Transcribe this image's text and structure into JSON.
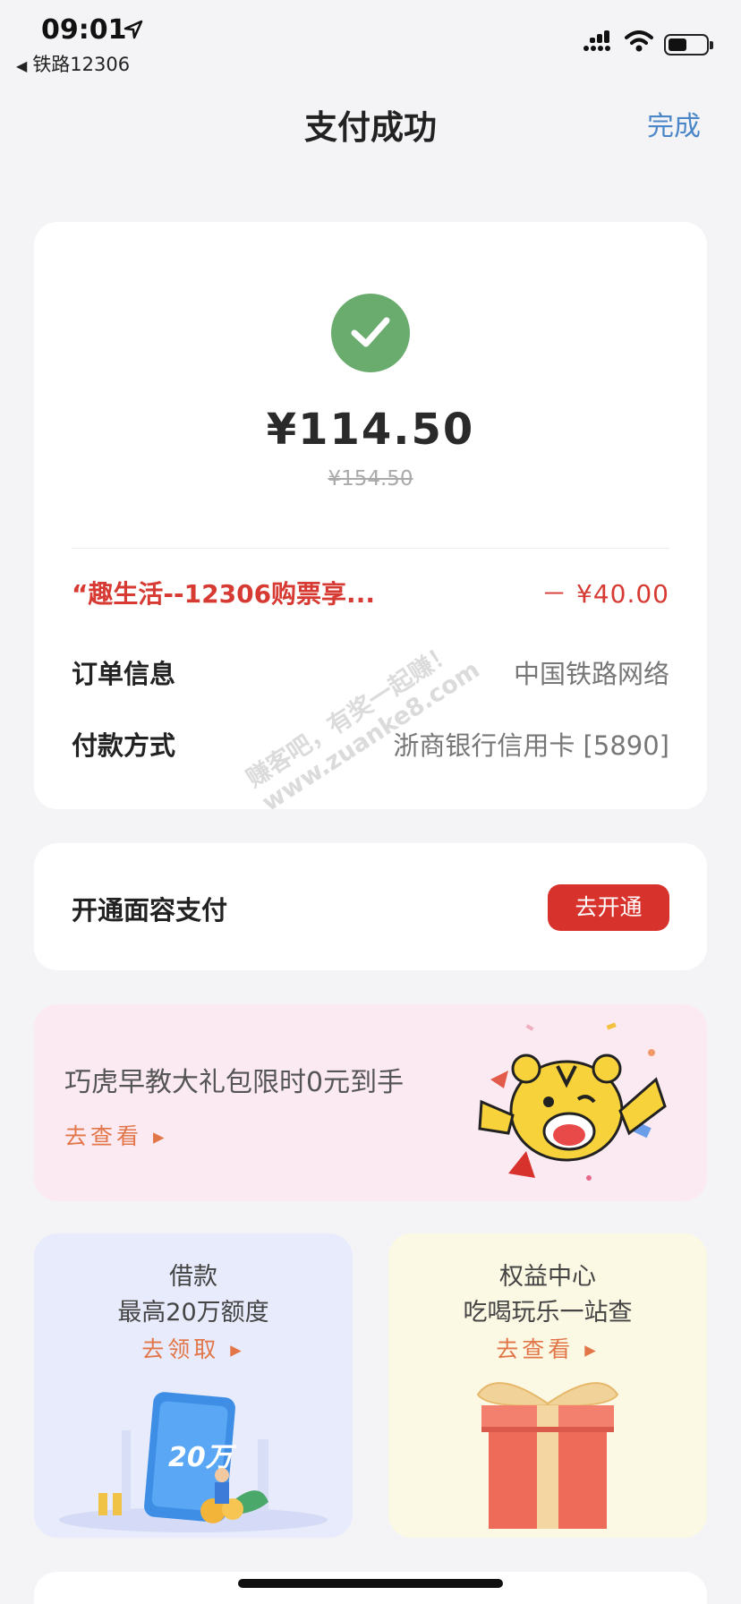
{
  "status_bar": {
    "time": "09:01",
    "back_app": "铁路12306"
  },
  "nav": {
    "title": "支付成功",
    "done": "完成"
  },
  "payment": {
    "amount": "¥114.50",
    "original_amount": "¥154.50",
    "discount_label": "“趣生活--12306购票享...",
    "discount_value": "－ ¥40.00",
    "order_label": "订单信息",
    "order_value": "中国铁路网络",
    "method_label": "付款方式",
    "method_value": "浙商银行信用卡 [5890]"
  },
  "face_pay": {
    "label": "开通面容支付",
    "button": "去开通"
  },
  "promo": {
    "title": "巧虎早教大礼包限时0元到手",
    "link": "去查看"
  },
  "tiles": {
    "loan": {
      "line1": "借款",
      "line2": "最高20万额度",
      "cta": "去领取",
      "art_text": "20万"
    },
    "perks": {
      "line1": "权益中心",
      "line2": "吃喝玩乐一站查",
      "cta": "去查看"
    }
  },
  "watermark": {
    "line1": "赚客吧，有奖一起赚！",
    "line2": "www.zuanke8.com"
  },
  "colors": {
    "accent_blue": "#4a86c8",
    "success_green": "#6aab6e",
    "discount_red": "#d63a32",
    "button_red": "#d8322c",
    "link_orange": "#e27648"
  }
}
